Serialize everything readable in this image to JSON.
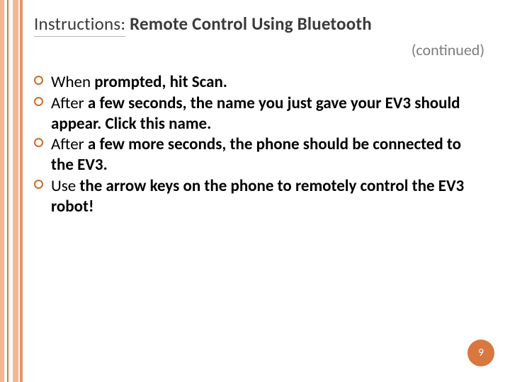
{
  "title": {
    "prefix": "Instructions:",
    "rest": " Remote Control Using Bluetooth"
  },
  "continued": "(continued)",
  "bullets": [
    {
      "pre": "When ",
      "bold": "prompted, hit Scan."
    },
    {
      "pre": "After ",
      "bold": "a few seconds, the name you just gave your EV3 should appear. Click this name."
    },
    {
      "pre": "After ",
      "bold": "a few more seconds, the phone should be connected to the EV3."
    },
    {
      "pre": "Use ",
      "bold": "the arrow keys on the phone to remotely control the EV3 robot!"
    }
  ],
  "pageNumber": "9"
}
